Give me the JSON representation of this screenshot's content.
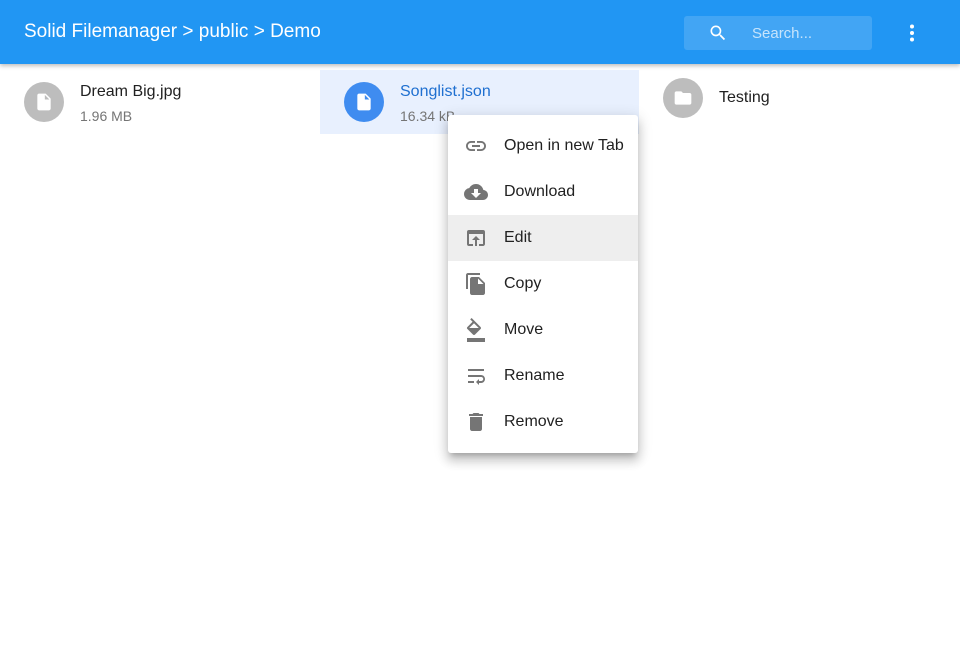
{
  "appbar": {
    "title": "Solid Filemanager > public > Demo",
    "search_placeholder": "Search...",
    "search_icon": "search-icon",
    "more_icon": "more-vert-icon"
  },
  "files": [
    {
      "name": "Dream Big.jpg",
      "size": "1.96 MB",
      "icon": "file-icon",
      "selected": false
    },
    {
      "name": "Songlist.json",
      "size": "16.34 kB",
      "icon": "file-icon",
      "selected": true
    },
    {
      "name": "Testing",
      "size": "",
      "icon": "folder-icon",
      "selected": false
    }
  ],
  "context_menu": {
    "items": [
      {
        "label": "Open in new Tab",
        "icon": "link-icon"
      },
      {
        "label": "Download",
        "icon": "cloud-download-icon"
      },
      {
        "label": "Edit",
        "icon": "open-in-browser-icon",
        "highlighted": true
      },
      {
        "label": "Copy",
        "icon": "copy-icon"
      },
      {
        "label": "Move",
        "icon": "move-icon"
      },
      {
        "label": "Rename",
        "icon": "wrap-text-icon"
      },
      {
        "label": "Remove",
        "icon": "delete-icon"
      }
    ]
  },
  "colors": {
    "appbar": "#2196f3",
    "selected_bg": "#e8f0fe",
    "selected_text": "#1e6fd0",
    "menu_highlight": "#eeeeee"
  }
}
